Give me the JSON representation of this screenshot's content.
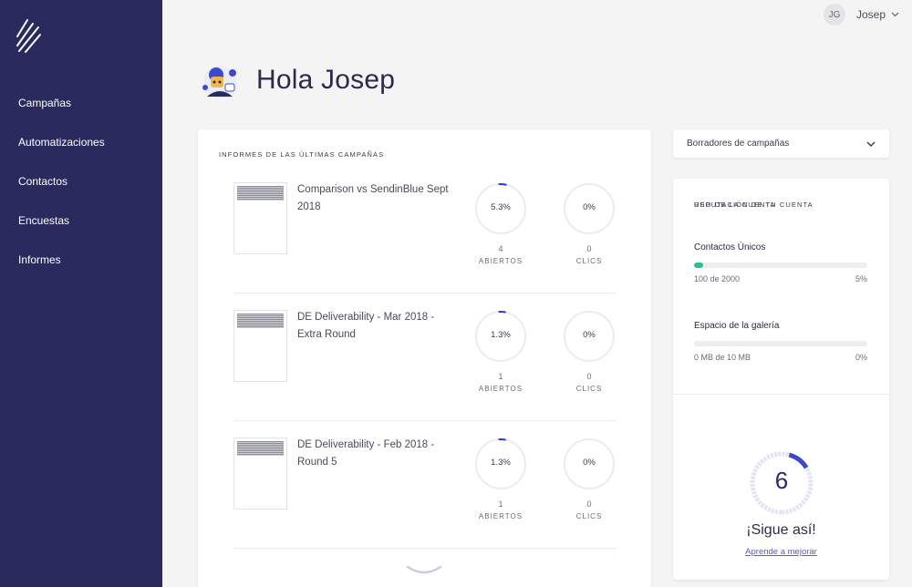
{
  "sidebar": {
    "items": [
      {
        "label": "Campañas"
      },
      {
        "label": "Automatizaciones"
      },
      {
        "label": "Contactos"
      },
      {
        "label": "Encuestas"
      },
      {
        "label": "Informes"
      }
    ]
  },
  "user": {
    "initials": "JG",
    "name": "Josep"
  },
  "greeting": "Hola Josep",
  "campaigns": {
    "title": "INFORMES DE LAS ÚLTIMAS CAMPAÑAS",
    "items": [
      {
        "name": "Comparison vs SendinBlue Sept 2018",
        "open_pct": "5.3%",
        "open_fraction": 0.053,
        "opens": "4",
        "click_pct": "0%",
        "clicks": "0",
        "opens_label": "ABIERTOS",
        "clicks_label": "CLICS"
      },
      {
        "name": "DE Deliverability - Mar 2018 - Extra Round",
        "open_pct": "1.3%",
        "open_fraction": 0.013,
        "opens": "1",
        "click_pct": "0%",
        "clicks": "0",
        "opens_label": "ABIERTOS",
        "clicks_label": "CLICS"
      },
      {
        "name": "DE Deliverability - Feb 2018 - Round 5",
        "open_pct": "1.3%",
        "open_fraction": 0.013,
        "opens": "1",
        "click_pct": "0%",
        "clicks": "0",
        "opens_label": "ABIERTOS",
        "clicks_label": "CLICS"
      }
    ]
  },
  "drafts": {
    "label": "Borradores de campañas"
  },
  "usage": {
    "title": "USO DE LA CUENTA",
    "contacts": {
      "label": "Contactos Únicos",
      "detail": "100 de 2000",
      "pct": "5%",
      "fraction": 0.05
    },
    "gallery": {
      "label": "Espacio de la galería",
      "detail": "0 MB de 10 MB",
      "pct": "0%",
      "fraction": 0
    },
    "reputation": {
      "title": "REPUTACIÓN DE TU CUENTA",
      "value": "6",
      "fraction": 0.6,
      "message": "¡Sigue así!",
      "link": "Aprende a mejorar"
    }
  },
  "colors": {
    "sidebar": "#2b2a5f",
    "accent": "#2b3bd6",
    "progress": "#2ac28a",
    "link": "#5a5acb"
  }
}
